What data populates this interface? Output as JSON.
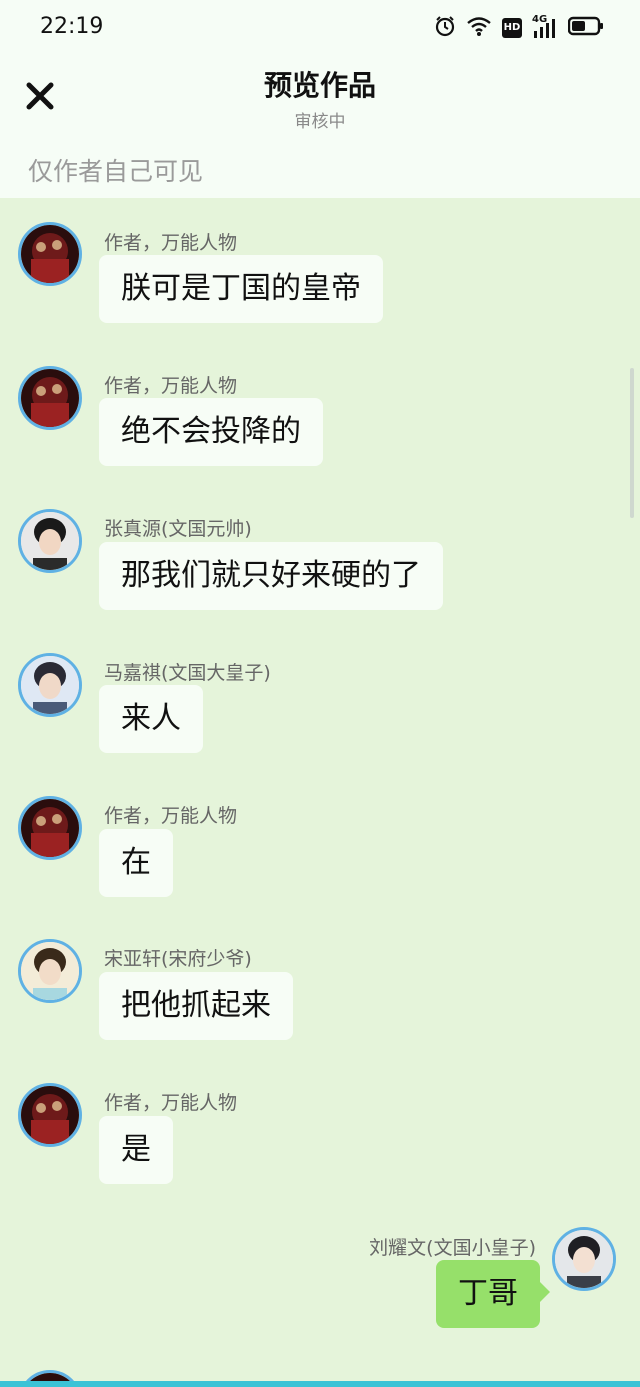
{
  "status_bar": {
    "time": "22:19",
    "icons": [
      "alarm-icon",
      "wifi-icon",
      "hd-icon",
      "signal-4g-icon",
      "battery-icon"
    ],
    "hd_label": "HD",
    "network_label": "4G"
  },
  "header": {
    "title": "预览作品",
    "subtitle": "审核中",
    "close_icon": "close-icon"
  },
  "notice": "仅作者自己可见",
  "messages": [
    {
      "name": "作者，万能人物",
      "text": "朕可是丁国的皇帝",
      "side": "left",
      "avatar": "author-avatar"
    },
    {
      "name": "作者，万能人物",
      "text": "绝不会投降的",
      "side": "left",
      "avatar": "author-avatar"
    },
    {
      "name": "张真源(文国元帅)",
      "text": "那我们就只好来硬的了",
      "side": "left",
      "avatar": "character-avatar"
    },
    {
      "name": "马嘉祺(文国大皇子)",
      "text": "来人",
      "side": "left",
      "avatar": "character-avatar"
    },
    {
      "name": "作者，万能人物",
      "text": "在",
      "side": "left",
      "avatar": "author-avatar"
    },
    {
      "name": "宋亚轩(宋府少爷)",
      "text": "把他抓起来",
      "side": "left",
      "avatar": "character-avatar"
    },
    {
      "name": "作者，万能人物",
      "text": "是",
      "side": "left",
      "avatar": "author-avatar"
    },
    {
      "name": "刘耀文(文国小皇子)",
      "text": "丁哥",
      "side": "right",
      "avatar": "character-avatar"
    }
  ],
  "colors": {
    "chat_background": "#e5f4da",
    "header_background": "#f6fdf6",
    "bubble_incoming": "#f7fdf6",
    "bubble_outgoing": "#96e06a",
    "avatar_ring": "#5fb1e4",
    "bottom_bar": "#3ac3d6"
  }
}
